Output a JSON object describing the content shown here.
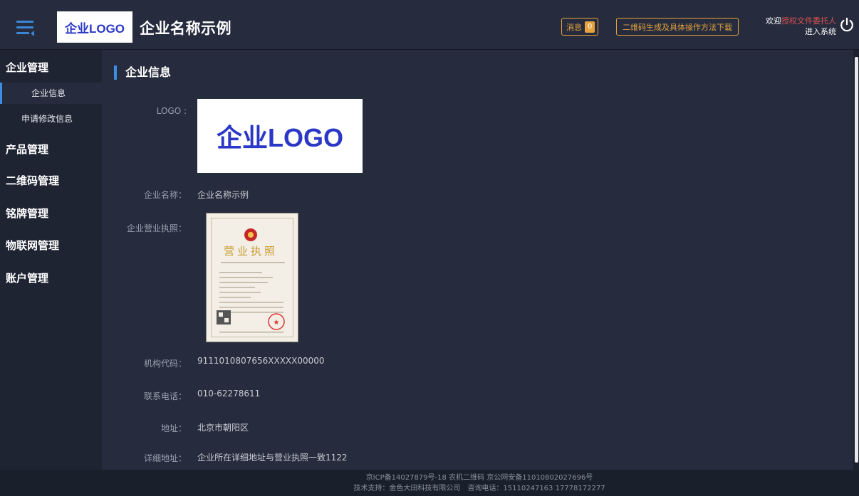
{
  "header": {
    "logo_text": "企业LOGO",
    "company_name": "企业名称示例",
    "message_label": "消息",
    "message_count": "0",
    "qr_download_label": "二维码生成及具体操作方法下载",
    "welcome_prefix": "欢迎",
    "welcome_user": "授权文件委托人",
    "enter_system": "进入系统",
    "menu_icon": "hamburger-menu-icon",
    "power_icon": "power-icon"
  },
  "sidebar": {
    "groups": [
      {
        "label": "企业管理",
        "items": [
          {
            "label": "企业信息",
            "active": true
          },
          {
            "label": "申请修改信息",
            "active": false
          }
        ]
      },
      {
        "label": "产品管理"
      },
      {
        "label": "二维码管理"
      },
      {
        "label": "铭牌管理"
      },
      {
        "label": "物联网管理"
      },
      {
        "label": "账户管理"
      }
    ]
  },
  "main": {
    "section_title": "企业信息",
    "logo_label": "LOGO :",
    "logo_image_text": "企业LOGO",
    "fields": [
      {
        "label": "企业名称：",
        "value": "企业名称示例"
      },
      {
        "label": "企业营业执照：",
        "value": ""
      },
      {
        "label": "机构代码：",
        "value": "9111010807656XXXXX00000"
      },
      {
        "label": "联系电话：",
        "value": "010-62278611"
      },
      {
        "label": "地址：",
        "value": "北京市朝阳区"
      },
      {
        "label": "详细地址：",
        "value": "企业所在详细地址与营业执照一致1122"
      }
    ],
    "license_stamp_text": "营业执照"
  },
  "footer": {
    "line1": "京ICP备14027879号-18 农机二维码 京公网安备11010802027696号",
    "line2": "技术支持：金色大田科技有限公司　咨询电话：15110247163 17778172277"
  },
  "colors": {
    "accent": "#3a8ee6",
    "warning": "#e6a23c",
    "user_highlight": "#e05252",
    "background": "#1f2433",
    "panel": "#262c3d"
  }
}
